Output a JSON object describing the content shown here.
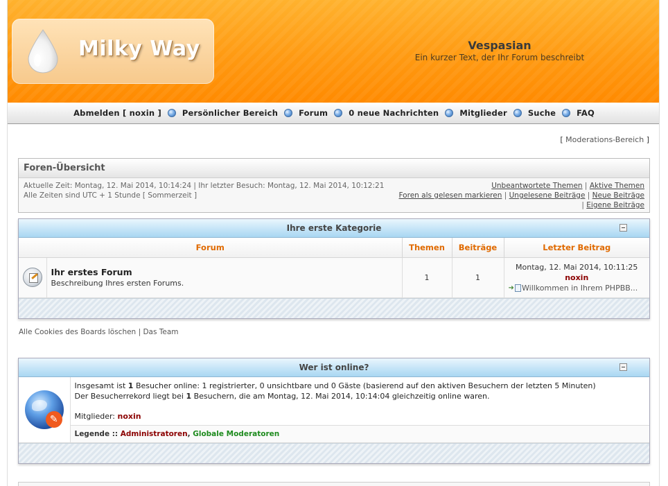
{
  "header": {
    "logo_text": "Milky Way",
    "site_name": "Vespasian",
    "site_description": "Ein kurzer Text, der Ihr Forum beschreibt"
  },
  "nav": {
    "items": [
      {
        "label": "Abmelden [ noxin ]"
      },
      {
        "label": "Persönlicher Bereich"
      },
      {
        "label": "Forum"
      },
      {
        "label": "0 neue Nachrichten"
      },
      {
        "label": "Mitglieder"
      },
      {
        "label": "Suche"
      },
      {
        "label": "FAQ"
      }
    ]
  },
  "moderation": {
    "bracket_open": "[",
    "label": "Moderations-Bereich",
    "bracket_close": "]"
  },
  "overview": {
    "title": "Foren-Übersicht",
    "current_time": "Aktuelle Zeit: Montag, 12. Mai 2014, 10:14:24 | Ihr letzter Besuch: Montag, 12. Mai 2014, 10:12:21",
    "timezone": "Alle Zeiten sind UTC + 1 Stunde [ Sommerzeit ]",
    "links": {
      "unanswered": "Unbeantwortete Themen",
      "active": "Aktive Themen",
      "mark_read": "Foren als gelesen markieren",
      "unread": "Ungelesene Beiträge",
      "new_posts": "Neue Beiträge",
      "own_posts": "Eigene Beiträge",
      "sep": "|"
    }
  },
  "category": {
    "title": "Ihre erste Kategorie",
    "columns": {
      "forum": "Forum",
      "topics": "Themen",
      "posts": "Beiträge",
      "last_post": "Letzter Beitrag"
    },
    "forums": [
      {
        "name": "Ihr erstes Forum",
        "description": "Beschreibung Ihres ersten Forums.",
        "topics": "1",
        "posts": "1",
        "last_post_date": "Montag, 12. Mai 2014, 10:11:25",
        "last_post_user": "noxin",
        "last_post_topic": "Willkommen in Ihrem PHPBB..."
      }
    ]
  },
  "footer_links": {
    "delete_cookies": "Alle Cookies des Boards löschen",
    "sep": "|",
    "team": "Das Team"
  },
  "online": {
    "title": "Wer ist online?",
    "line1_pre": "Insgesamt ist ",
    "line1_count": "1",
    "line1_post": " Besucher online: 1 registrierter, 0 unsichtbare und 0 Gäste (basierend auf den aktiven Besuchern der letzten 5 Minuten)",
    "line2_pre": "Der Besucherrekord liegt bei ",
    "line2_count": "1",
    "line2_post": " Besuchern, die am Montag, 12. Mai 2014, 10:14:04 gleichzeitig online waren.",
    "members_label": "Mitglieder: ",
    "members_user": "noxin",
    "legend_label": "Legende :: ",
    "legend_admin": "Administratoren",
    "legend_comma": ", ",
    "legend_gmod": "Globale Moderatoren"
  },
  "colors": {
    "header_orange": "#ff9a12",
    "category_blue": "#a9d7f2",
    "column_header_text": "#e06a00",
    "username_red": "#8b0000",
    "moderator_green": "#1e8b1e"
  }
}
